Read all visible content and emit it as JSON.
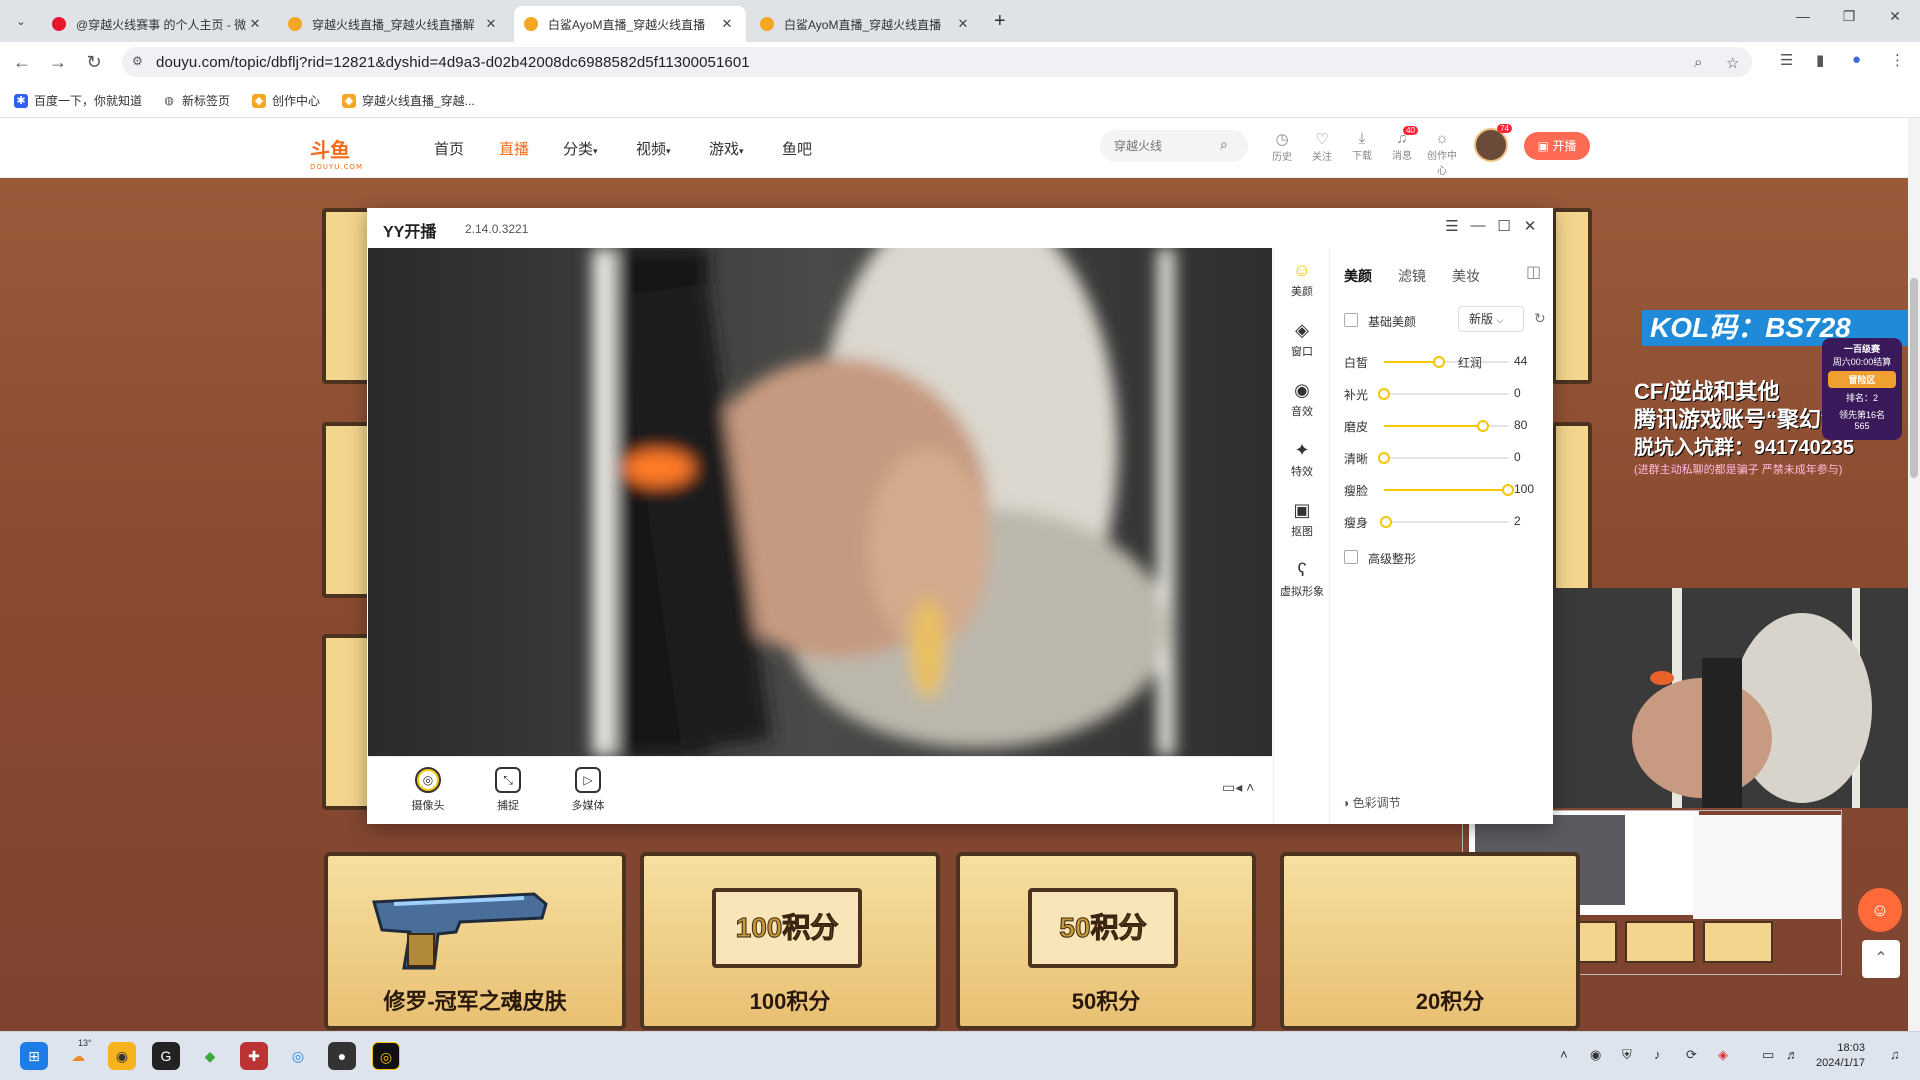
{
  "browser": {
    "tabs": [
      {
        "title": "@穿越火线赛事 的个人主页 - 微",
        "color": "#e6162d"
      },
      {
        "title": "穿越火线直播_穿越火线直播解",
        "color": "#f5a623"
      },
      {
        "title": "白鲨AyoM直播_穿越火线直播",
        "color": "#f5a623"
      },
      {
        "title": "白鲨AyoM直播_穿越火线直播",
        "color": "#f5a623"
      }
    ],
    "url": "douyu.com/topic/dbflj?rid=12821&dyshid=4d9a3-d02b42008dc6988582d5f11300051601",
    "bookmarks": [
      "百度一下，你就知道",
      "新标签页",
      "创作中心",
      "穿越火线直播_穿越..."
    ]
  },
  "site": {
    "logo": "斗鱼",
    "logo_sub": "DOUYU.COM",
    "nav": [
      "首页",
      "直播",
      "分类",
      "视频",
      "游戏",
      "鱼吧"
    ],
    "active_nav": "直播",
    "search_placeholder": "穿越火线",
    "icons": [
      {
        "label": "历史",
        "icon": "clock-icon"
      },
      {
        "label": "关注",
        "icon": "heart-icon"
      },
      {
        "label": "下载",
        "icon": "download-icon"
      },
      {
        "label": "消息",
        "icon": "bell-icon",
        "badge": "40"
      },
      {
        "label": "创作中心",
        "icon": "bulb-icon"
      }
    ],
    "avatar_badge": "74",
    "golive": "开播"
  },
  "yy": {
    "name": "YY开播",
    "version": "2.14.0.3221",
    "side": [
      "美颜",
      "窗口",
      "音效",
      "特效",
      "抠图",
      "虚拟形象"
    ],
    "tabs": [
      "美颜",
      "滤镜",
      "美妆"
    ],
    "basic_beauty": "基础美颜",
    "version_select": "新版",
    "sliders": [
      {
        "label": "白皙",
        "value": 44,
        "tag": "红润"
      },
      {
        "label": "补光",
        "value": 0
      },
      {
        "label": "磨皮",
        "value": 80
      },
      {
        "label": "清晰",
        "value": 0
      },
      {
        "label": "瘦脸",
        "value": 100
      },
      {
        "label": "瘦身",
        "value": 2
      }
    ],
    "advanced": "高级整形",
    "color_adjust": "色彩调节",
    "tools": [
      "摄像头",
      "捕捉",
      "多媒体"
    ]
  },
  "event": {
    "prizes": [
      {
        "label": "修罗-冠军之魂皮肤",
        "plaque": ""
      },
      {
        "label": "100积分",
        "plaque": "100积分"
      },
      {
        "label": "50积分",
        "plaque": "50积分"
      },
      {
        "label": "20积分",
        "plaque": ""
      }
    ],
    "promo_lines": [
      "CF/逆战和其他",
      "腾讯游戏账号“聚幻游”",
      "脱坑入坑群：941740235",
      "(进群主动私聊的都是骗子 严禁未成年参与)"
    ],
    "kol": "KOL码：BS728",
    "rank": {
      "title": "一百级赛",
      "sub": "周六00:00结算",
      "zone": "冒险区",
      "rank_label": "排名：2",
      "lead": "领先第16名",
      "score": "565"
    }
  },
  "taskbar": {
    "weather": "13°",
    "time": "18:03",
    "date": "2024/1/17"
  }
}
